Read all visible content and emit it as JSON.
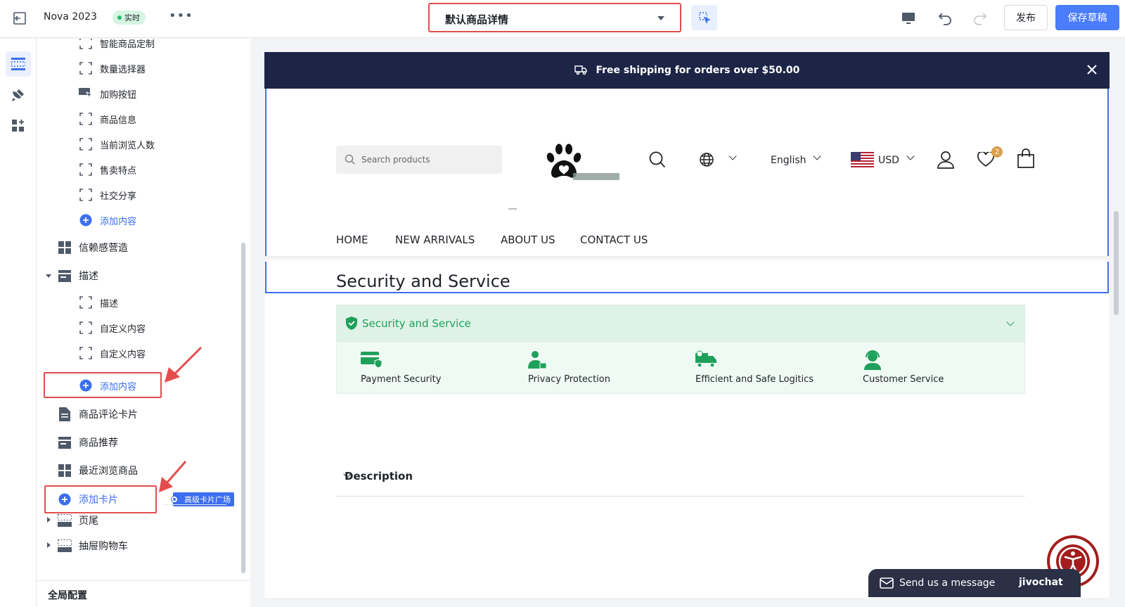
{
  "topbar": {
    "app_name": "Nova 2023",
    "live_badge": "实时",
    "page_select": "默认商品详情",
    "publish_label": "发布",
    "save_draft_label": "保存草稿"
  },
  "tree": {
    "items": [
      {
        "label": "智能商品定制"
      },
      {
        "label": "数量选择器"
      },
      {
        "label": "加购按钮"
      },
      {
        "label": "商品信息"
      },
      {
        "label": "当前浏览人数"
      },
      {
        "label": "售卖特点"
      },
      {
        "label": "社交分享"
      },
      {
        "label": "添加内容"
      },
      {
        "label": "信赖感营造"
      },
      {
        "label": "描述"
      },
      {
        "label": "描述"
      },
      {
        "label": "自定义内容"
      },
      {
        "label": "自定义内容"
      },
      {
        "label": "添加内容"
      },
      {
        "label": "商品评论卡片"
      },
      {
        "label": "商品推荐"
      },
      {
        "label": "最近浏览商品"
      },
      {
        "label": "添加卡片"
      },
      {
        "label": "页尾"
      },
      {
        "label": "抽屉购物车"
      }
    ],
    "advanced_badge": "高级卡片广场",
    "global_config": "全局配置"
  },
  "preview": {
    "promo_text": "Free shipping for orders over $50.00",
    "search_placeholder": "Search products",
    "language": "English",
    "currency": "USD",
    "wishlist_count": "2",
    "nav": [
      "HOME",
      "NEW ARRIVALS",
      "ABOUT US",
      "CONTACT US"
    ],
    "section_title": "Security and Service",
    "accordion_title": "Security and Service",
    "features": [
      "Payment Security",
      "Privacy Protection",
      "Efficient and Safe Logitics",
      "Customer Service"
    ],
    "description_title": "Description"
  },
  "chat": {
    "message": "Send us a message",
    "brand": "jivochat"
  },
  "colors": {
    "accent": "#4a7dfc",
    "highlight_red": "#e34d4d",
    "promo_bar": "#1d2547",
    "success_green": "#1fa05a"
  }
}
